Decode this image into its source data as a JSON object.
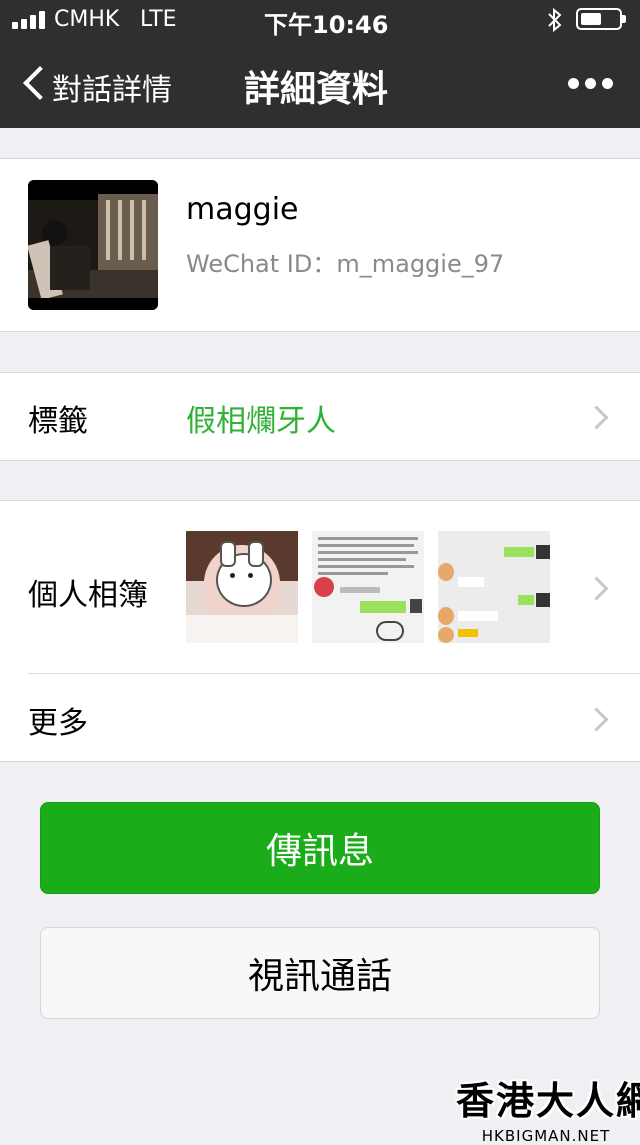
{
  "status_bar": {
    "carrier": "CMHK",
    "network": "LTE",
    "time": "下午10:46"
  },
  "nav": {
    "back_label": "對話詳情",
    "title": "詳細資料",
    "more_icon": "more-dots-icon"
  },
  "profile": {
    "name": "maggie",
    "wechat_id": "WeChat ID：m_maggie_97"
  },
  "tag_row": {
    "label": "標籤",
    "value": "假相爛牙人"
  },
  "album_row": {
    "label": "個人相簿"
  },
  "more_row": {
    "label": "更多"
  },
  "buttons": {
    "message": "傳訊息",
    "video_call": "視訊通話"
  },
  "watermark": {
    "title": "香港大人網",
    "url": "HKBIGMAN.NET"
  },
  "colors": {
    "nav_bg": "#2f2f32",
    "accent_green": "#1aad19",
    "tag_green": "#2fb233"
  }
}
